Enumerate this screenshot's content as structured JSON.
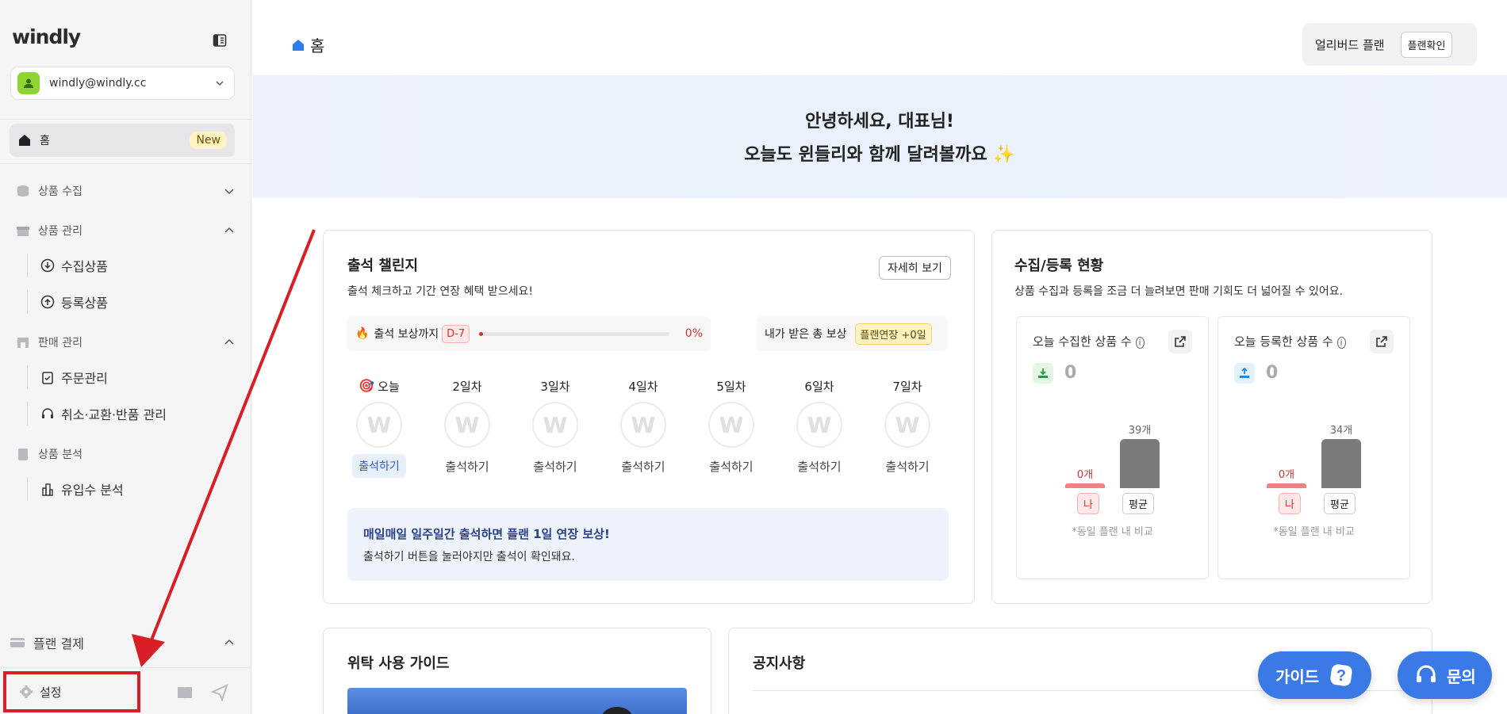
{
  "sidebar": {
    "logo": "windly",
    "account_email": "windly@windly.cc",
    "home_label": "홈",
    "home_badge": "New",
    "sections": {
      "collect": "상품 수집",
      "manage": "상품 관리",
      "collected": "수집상품",
      "registered": "등록상품",
      "sales": "판매 관리",
      "orders": "주문관리",
      "returns": "취소·교환·반품 관리",
      "analysis": "상품 분석",
      "traffic": "유입수 분석"
    },
    "plan_payment": "플랜 결제",
    "settings": "설정"
  },
  "header": {
    "title": "홈",
    "plan_name": "얼리버드 플랜",
    "plan_check": "플랜확인"
  },
  "banner": {
    "line1": "안녕하세요, 대표님!",
    "line2": "오늘도 윈들리와 함께 달려볼까요 ✨"
  },
  "attendance": {
    "title": "출석 챌린지",
    "subtitle": "출석 체크하고 기간 연장 혜택 받으세요!",
    "detail_button": "자세히 보기",
    "reward_until": "출석 보상까지",
    "dday": "D-7",
    "progress": 0,
    "progress_text": "0%",
    "total_reward_label": "내가 받은 총 보상",
    "total_reward_value": "플랜연장 +0일",
    "days": [
      {
        "label": "오늘",
        "button": "출석하기"
      },
      {
        "label": "2일차",
        "button": "출석하기"
      },
      {
        "label": "3일차",
        "button": "출석하기"
      },
      {
        "label": "4일차",
        "button": "출석하기"
      },
      {
        "label": "5일차",
        "button": "출석하기"
      },
      {
        "label": "6일차",
        "button": "출석하기"
      },
      {
        "label": "7일차",
        "button": "출석하기"
      }
    ],
    "info_title": "매일매일 일주일간 출석하면 플랜 1일 연장 보상!",
    "info_text": "출석하기 버튼을 눌러야지만 출석이 확인돼요."
  },
  "stats": {
    "title": "수집/등록 현황",
    "subtitle": "상품 수집과 등록을 조금 더 늘려보면 판매 기회도 더 넓어질 수 있어요.",
    "collected": {
      "title": "오늘 수집한 상품 수",
      "value": "0",
      "me_label": "0개",
      "avg_label": "39개",
      "me": 0,
      "avg": 39,
      "tag_me": "나",
      "tag_avg": "평균",
      "compare": "*동일 플랜 내 비교"
    },
    "registered": {
      "title": "오늘 등록한 상품 수",
      "value": "0",
      "me_label": "0개",
      "avg_label": "34개",
      "me": 0,
      "avg": 34,
      "tag_me": "나",
      "tag_avg": "평균",
      "compare": "*동일 플랜 내 비교"
    }
  },
  "guide": {
    "title": "위탁 사용 가이드"
  },
  "notice": {
    "title": "공지사항"
  },
  "fab": {
    "guide": "가이드",
    "inquiry": "문의"
  },
  "colors": {
    "accent": "#3b7ae6",
    "highlight": "#d81f26"
  }
}
